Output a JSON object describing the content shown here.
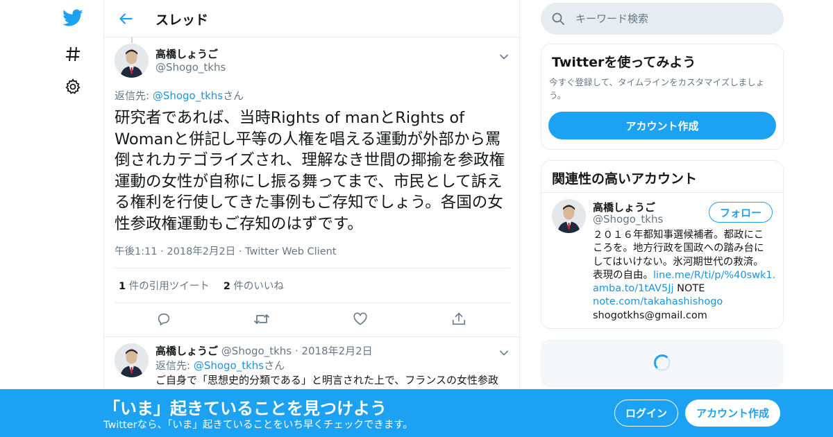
{
  "colors": {
    "accent": "#1da1f2",
    "text": "#14171a",
    "secondary": "#657786",
    "border": "#e6ecf0"
  },
  "nav": {
    "icons": [
      "twitter-bird-icon",
      "hashtag-icon",
      "gear-icon"
    ]
  },
  "header": {
    "title": "スレッド"
  },
  "main_tweet": {
    "name": "高橋しょうご",
    "handle": "@Shogo_tkhs",
    "reply_prefix": "返信先: ",
    "reply_handle": "@Shogo_tkhs",
    "reply_suffix": "さん",
    "text": "研究者であれば、当時Rights of manとRights of Womanと併記し平等の人権を唱える運動が外部から罵倒されカテゴライズされ、理解なき世間の揶揄を参政権運動の女性が自称にし振る舞ってまで、市民として訴える権利を行使してきた事例もご存知でしょう。各国の女性参政権運動もご存知のはずです。",
    "time": "午後1:11",
    "date": "2018年2月2日",
    "source": "Twitter Web Client",
    "quote_count": "1",
    "quote_label": "件の引用ツイート",
    "like_count": "2",
    "like_label": "件のいいね",
    "actions": [
      "reply-icon",
      "retweet-icon",
      "like-icon",
      "share-icon"
    ]
  },
  "reply_tweet": {
    "name": "高橋しょうご",
    "handle": "@Shogo_tkhs",
    "date": "2018年2月2日",
    "reply_prefix": "返信先: ",
    "reply_handle": "@Shogo_tkhs",
    "reply_suffix": "さん",
    "text": "ご自身で「思想史的分類である」と明言された上で、フランスの女性参政"
  },
  "search": {
    "placeholder": "キーワード検索"
  },
  "signup_card": {
    "title": "Twitterを使ってみよう",
    "description": "今すぐ登録して、タイムラインをカスタマイズしましょう。",
    "button": "アカウント作成"
  },
  "related": {
    "title": "関連性の高いアカウント",
    "name": "高橋しょうご",
    "handle": "@Shogo_tkhs",
    "follow": "フォロー",
    "bio_lines": [
      "２０１６年都知事選候補者。都政にこ",
      "ころを。地方行政を国政への踏み台に",
      "してはいけない。氷河期世代の救済。"
    ],
    "bio_line4_text": "表現の自由。",
    "bio_link1": "line.me/R/ti/p/%40swk1...",
    "bio_link2": "amba.to/1tAV5Jj",
    "bio_note": " NOTE",
    "bio_link3": "note.com/takahashishogo",
    "bio_email": "shogotkhs@gmail.com"
  },
  "banner": {
    "title": "「いま」起きていることを見つけよう",
    "subtitle": "Twitterなら、「いま」起きていることをいち早くチェックできます。",
    "login": "ログイン",
    "signup": "アカウント作成"
  }
}
